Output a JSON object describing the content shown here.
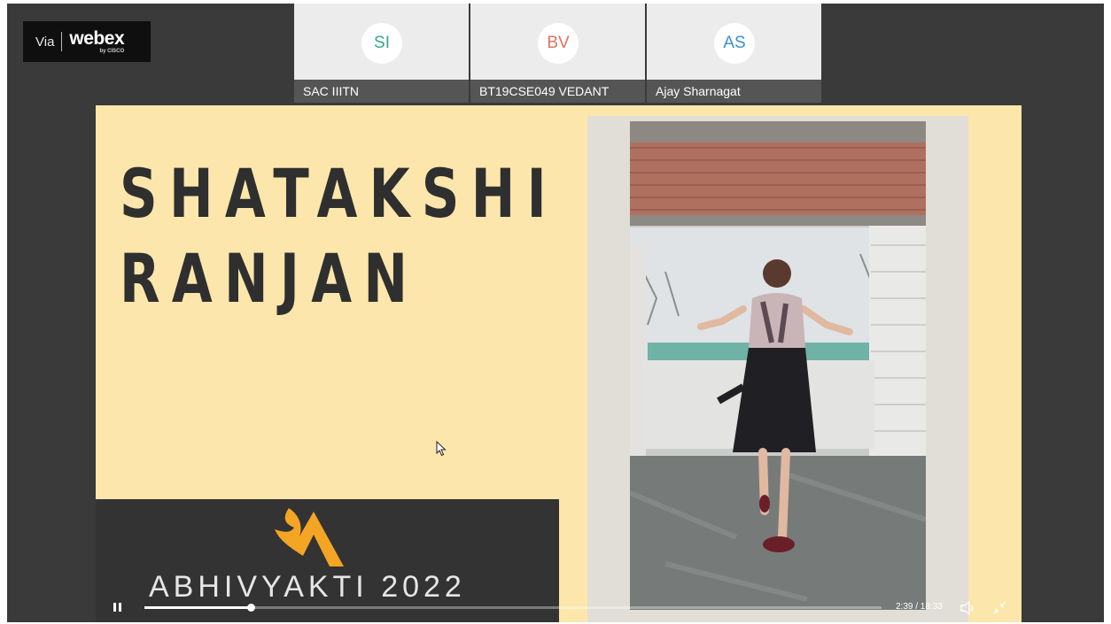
{
  "badge": {
    "via": "Via",
    "brand": "webex",
    "by": "by CISCO"
  },
  "participants": [
    {
      "initials": "SI",
      "name": "SAC IIITN",
      "color": "#3aa88a"
    },
    {
      "initials": "BV",
      "name": "BT19CSE049 VEDANT",
      "color": "#e0735d"
    },
    {
      "initials": "AS",
      "name": "Ajay Sharnagat",
      "color": "#3b8fd1"
    }
  ],
  "slide": {
    "name_line1": "SHATAKSHI",
    "name_line2": "RANJAN",
    "event_title": "ABHIVYAKTI 2022",
    "logo_color": "#f4a524",
    "background_color": "#fce6ab"
  },
  "player": {
    "time": "2:39 / 18:33",
    "progress": 0.144,
    "state": "playing",
    "icons": {
      "pause": "pause-icon",
      "volume": "volume-icon",
      "fullscreen": "exit-fullscreen-icon"
    }
  }
}
